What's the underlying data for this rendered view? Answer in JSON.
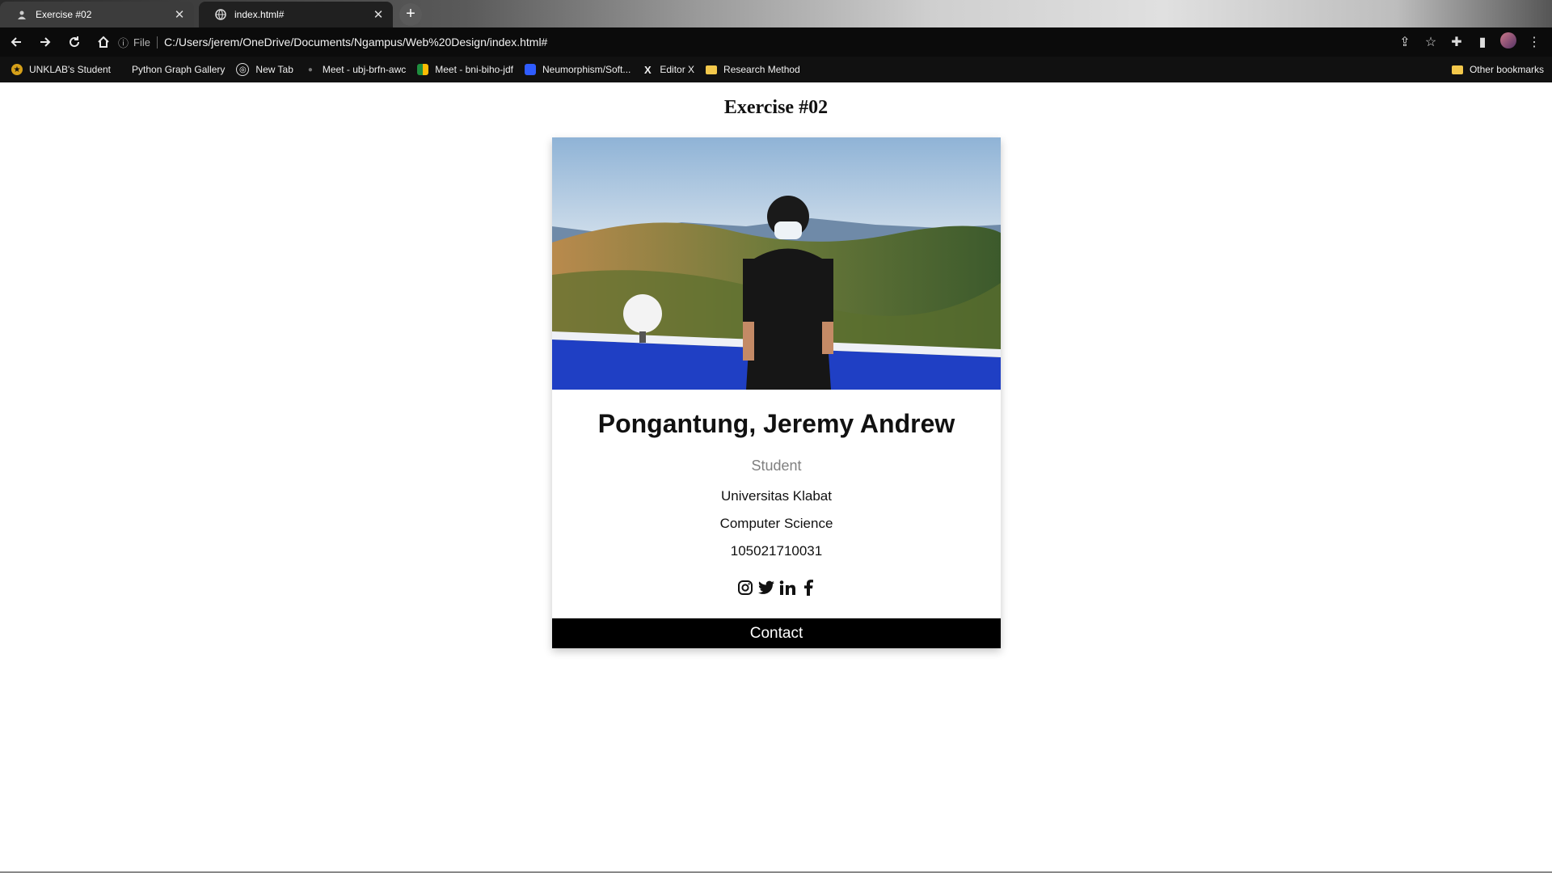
{
  "browser": {
    "tabs": [
      {
        "title": "Exercise #02",
        "active": true
      },
      {
        "title": "index.html#",
        "active": false
      }
    ],
    "address": {
      "security_label": "File",
      "url": "C:/Users/jerem/OneDrive/Documents/Ngampus/Web%20Design/index.html#"
    },
    "bookmarks": [
      {
        "label": "UNKLAB's Student",
        "icon": "unklab-logo-icon"
      },
      {
        "label": "Python Graph Gallery",
        "icon": "blank-icon"
      },
      {
        "label": "New Tab",
        "icon": "newtab-icon"
      },
      {
        "label": "Meet - ubj-brfn-awc",
        "icon": "meet-icon"
      },
      {
        "label": "Meet - bni-biho-jdf",
        "icon": "meet-icon"
      },
      {
        "label": "Neumorphism/Soft...",
        "icon": "neumorphism-icon"
      },
      {
        "label": "Editor X",
        "icon": "editorx-icon"
      },
      {
        "label": "Research Method",
        "icon": "folder-icon"
      }
    ],
    "other_bookmarks": "Other bookmarks"
  },
  "page": {
    "heading": "Exercise #02",
    "card": {
      "name": "Pongantung, Jeremy Andrew",
      "title": "Student",
      "university": "Universitas Klabat",
      "major": "Computer Science",
      "student_id": "105021710031",
      "socials": [
        "instagram-icon",
        "twitter-icon",
        "linkedin-icon",
        "facebook-icon"
      ],
      "contact_label": "Contact"
    }
  },
  "colors": {
    "card_title": "#808080",
    "contact_bg": "#000000",
    "contact_text": "#ffffff"
  }
}
